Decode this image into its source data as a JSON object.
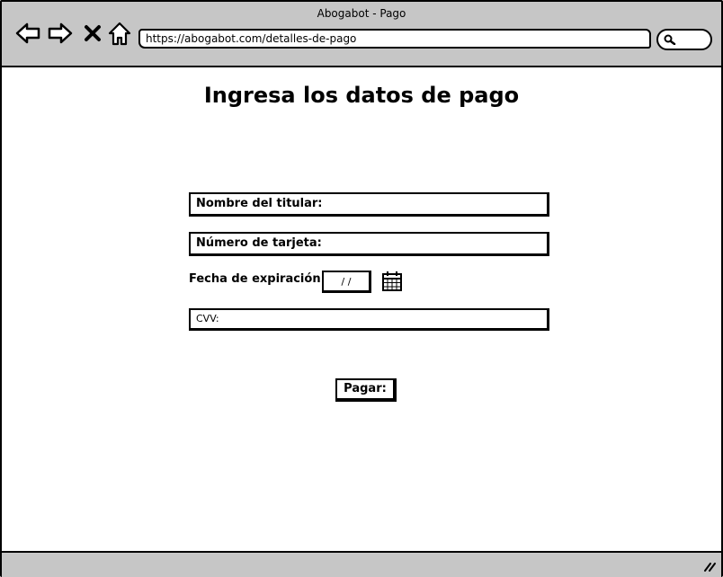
{
  "window": {
    "title": "Abogabot - Pago",
    "url": "https://abogabot.com/detalles-de-pago"
  },
  "toolbar": {
    "icons": [
      "back-arrow-icon",
      "forward-arrow-icon",
      "close-x-icon",
      "home-icon",
      "search-icon",
      "resize-grip-icon"
    ]
  },
  "page": {
    "title": "Ingresa los datos de pago"
  },
  "form": {
    "holder_label": "Nombre del titular:",
    "card_label": "Número de tarjeta:",
    "expiration_label": "Fecha de expiración:",
    "expiration_value": "/ /",
    "calendar_icon": "calendar-icon",
    "cvv_label": "CVV:",
    "pay_button": "Pagar:"
  },
  "colors": {
    "chrome": "#c6c6c6",
    "background": "#ffffff",
    "ink": "#000000"
  }
}
